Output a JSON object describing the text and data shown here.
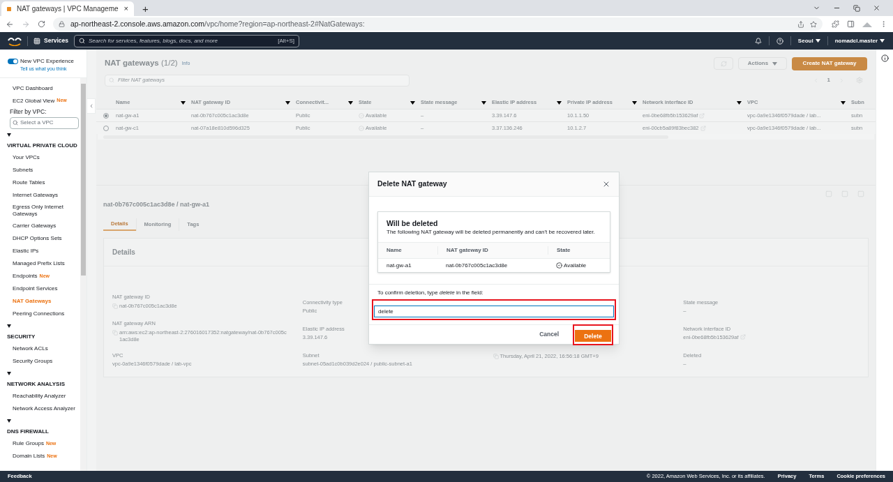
{
  "browser": {
    "tab": {
      "title": "NAT gateways | VPC Manageme",
      "close": "×"
    },
    "new_tab": "+",
    "url": {
      "host": "ap-northeast-2.console.aws.amazon.com",
      "path": "/vpc/home?region=ap-northeast-2#NatGateways:"
    }
  },
  "aws_nav": {
    "services": "Services",
    "search": {
      "placeholder": "Search for services, features, blogs, docs, and more",
      "shortcut": "[Alt+S]"
    },
    "region": "Seoul",
    "account": "nomadcl.master"
  },
  "sidebar": {
    "toggle": {
      "label": "New VPC Experience",
      "on": true,
      "link": "Tell us what you think"
    },
    "top_items": [
      {
        "label": "VPC Dashboard",
        "selected": false
      },
      {
        "label": "EC2 Global View",
        "badge": "New",
        "selected": false
      }
    ],
    "filter": {
      "label": "Filter by VPC:",
      "placeholder": "Select a VPC"
    },
    "sections": [
      {
        "title": "VIRTUAL PRIVATE CLOUD",
        "expanded": true,
        "items": [
          {
            "label": "Your VPCs",
            "selected": false
          },
          {
            "label": "Subnets",
            "selected": false
          },
          {
            "label": "Route Tables",
            "selected": false
          },
          {
            "label": "Internet Gateways",
            "selected": false
          },
          {
            "label": "Egress Only Internet Gateways",
            "selected": false
          },
          {
            "label": "Carrier Gateways",
            "selected": false
          },
          {
            "label": "DHCP Options Sets",
            "selected": false
          },
          {
            "label": "Elastic IPs",
            "selected": false
          },
          {
            "label": "Managed Prefix Lists",
            "selected": false
          },
          {
            "label": "Endpoints",
            "badge": "New",
            "selected": false
          },
          {
            "label": "Endpoint Services",
            "selected": false
          },
          {
            "label": "NAT Gateways",
            "selected": true
          },
          {
            "label": "Peering Connections",
            "selected": false
          }
        ]
      },
      {
        "title": "SECURITY",
        "expanded": true,
        "items": [
          {
            "label": "Network ACLs",
            "selected": false
          },
          {
            "label": "Security Groups",
            "selected": false
          }
        ]
      },
      {
        "title": "NETWORK ANALYSIS",
        "expanded": true,
        "items": [
          {
            "label": "Reachability Analyzer",
            "selected": false
          },
          {
            "label": "Network Access Analyzer",
            "selected": false
          }
        ]
      },
      {
        "title": "DNS FIREWALL",
        "expanded": true,
        "items": [
          {
            "label": "Rule Groups",
            "badge": "New",
            "selected": false
          },
          {
            "label": "Domain Lists",
            "badge": "New",
            "selected": false
          }
        ]
      }
    ]
  },
  "list": {
    "title": "NAT gateways",
    "count": "(1/2)",
    "info": "Info",
    "actions": "Actions",
    "create": "Create NAT gateway",
    "filter_placeholder": "Filter NAT gateways",
    "page": "1",
    "columns": [
      "Name",
      "NAT gateway ID",
      "Connectivit...",
      "State",
      "State message",
      "Elastic IP address",
      "Private IP address",
      "Network interface ID",
      "VPC",
      "Subn"
    ],
    "rows": [
      {
        "selected": true,
        "cells": [
          "nat-gw-a1",
          "nat-0b767c005c1ac3d8e",
          "Public",
          "Available",
          "–",
          "3.39.147.6",
          "10.1.1.50",
          "eni-0be68fb5b153629af",
          "vpc-0a9e1346f0579dade / lab...",
          "subn"
        ]
      },
      {
        "selected": false,
        "cells": [
          "nat-gw-c1",
          "nat-07a18e810d596d325",
          "Public",
          "Available",
          "–",
          "3.37.136.246",
          "10.1.2.7",
          "eni-00cb5a89f83bec382",
          "vpc-0a9e1346f0579dade / lab...",
          "subn"
        ]
      }
    ]
  },
  "detail": {
    "title": "nat-0b767c005c1ac3d8e / nat-gw-a1",
    "tabs": [
      {
        "label": "Details",
        "selected": true
      },
      {
        "label": "Monitoring",
        "selected": false
      },
      {
        "label": "Tags",
        "selected": false
      }
    ],
    "card_title": "Details",
    "columns": [
      [
        {
          "label": "NAT gateway ID",
          "value": "nat-0b767c005c1ac3d8e",
          "copy": true
        },
        {
          "label": "NAT gateway ARN",
          "value": "arn:aws:ec2:ap-northeast-2:276016017352:natgateway/nat-0b767c005c1ac3d8e",
          "copy": true
        },
        {
          "label": "VPC",
          "value": "vpc-0a9e1346f0579dade / lab-vpc",
          "copy": false
        }
      ],
      [
        {
          "label": "Connectivity type",
          "value": "Public",
          "copy": false
        },
        {
          "label": "Elastic IP address",
          "value": "3.39.147.6",
          "copy": false
        },
        {
          "label": "Subnet",
          "value": "subnet-05ad1c0b039d2e024 / public-subnet-a1",
          "copy": false
        }
      ],
      [
        {
          "value": "Thursday, April 21, 2022, 16:56:18 GMT+9",
          "copy": true
        }
      ],
      [
        {
          "label": "State message",
          "value": "–",
          "copy": false
        },
        {
          "label": "Network interface ID",
          "value": "eni-0be68fb5b153629af",
          "copy": false,
          "external": true
        },
        {
          "label": "Deleted",
          "value": "–",
          "copy": false
        }
      ]
    ]
  },
  "modal": {
    "title": "Delete NAT gateway",
    "box_title": "Will be deleted",
    "box_text": "The following NAT gateway will be deleted permanently and can't be recovered later.",
    "columns": [
      "Name",
      "NAT gateway ID",
      "State"
    ],
    "row": [
      "nat-gw-a1",
      "nat-0b767c005c1ac3d8e",
      "Available"
    ],
    "confirm_label": "To confirm deletion, type *delete* in the field:",
    "confirm_value": "delete",
    "cancel": "Cancel",
    "delete": "Delete"
  },
  "footer": {
    "feedback": "Feedback",
    "copyright": "© 2022, Amazon Web Services, Inc. or its affiliates.",
    "links": [
      "Privacy",
      "Terms",
      "Cookie preferences"
    ]
  }
}
